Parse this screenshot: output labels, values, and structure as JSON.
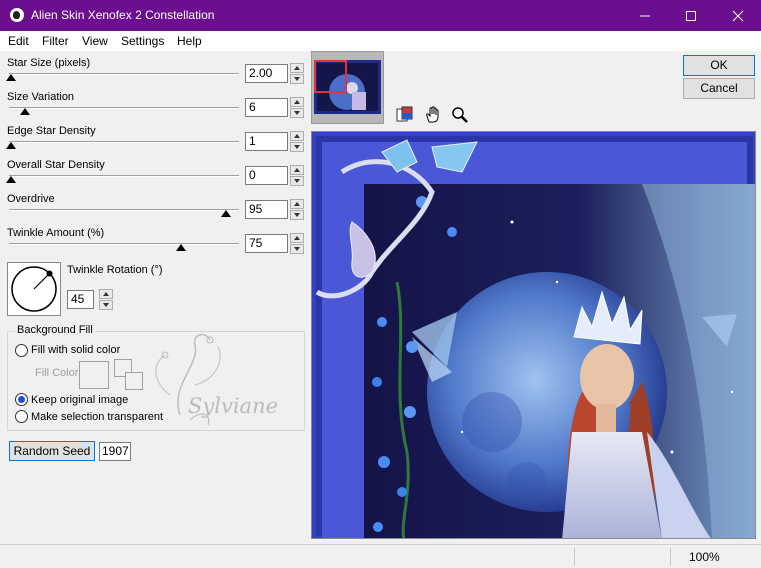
{
  "window": {
    "title": "Alien Skin Xenofex 2 Constellation"
  },
  "menu": [
    "Edit",
    "Filter",
    "View",
    "Settings",
    "Help"
  ],
  "sliders": [
    {
      "label": "Star Size (pixels)",
      "value": "2.00",
      "position": 0.0
    },
    {
      "label": "Size Variation",
      "value": "6",
      "position": 0.06
    },
    {
      "label": "Edge Star Density",
      "value": "1",
      "position": 0.0
    },
    {
      "label": "Overall Star Density",
      "value": "0",
      "position": 0.0
    },
    {
      "label": "Overdrive",
      "value": "95",
      "position": 0.95
    },
    {
      "label": "Twinkle Amount (%)",
      "value": "75",
      "position": 0.75
    }
  ],
  "twinkle_rotation": {
    "label": "Twinkle Rotation (°)",
    "value": "45"
  },
  "background_fill": {
    "legend": "Background Fill",
    "options": [
      {
        "label": "Fill with solid color",
        "checked": false
      },
      {
        "label": "Keep original image",
        "checked": true
      },
      {
        "label": "Make selection transparent",
        "checked": false
      }
    ],
    "fill_color_label": "Fill Color"
  },
  "watermark_text": "Sylviane",
  "random_seed": {
    "button_label": "Random Seed",
    "value": "1907"
  },
  "buttons": {
    "ok": "OK",
    "cancel": "Cancel"
  },
  "status": {
    "zoom": "100%"
  },
  "colors": {
    "titlebar": "#6b0f8f",
    "frame": "#3a45c0",
    "accent": "#0078d7"
  },
  "icons": [
    "alien-skin-icon",
    "minimize-icon",
    "maximize-icon",
    "close-icon",
    "compare-icon",
    "hand-icon",
    "zoom-icon"
  ]
}
